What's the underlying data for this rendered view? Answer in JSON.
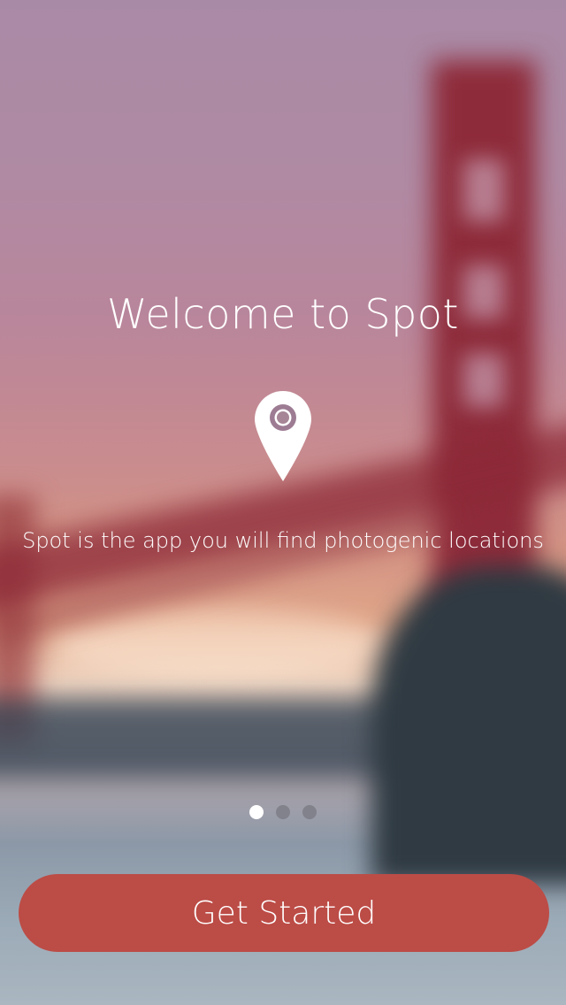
{
  "onboarding": {
    "title": "Welcome to Spot",
    "subtitle": "Spot is the app you will find photogenic locations",
    "pin_icon": "map-pin-icon",
    "pages": {
      "count": 3,
      "active_index": 0
    },
    "cta_label": "Get Started"
  },
  "colors": {
    "accent": "#bc4c46",
    "text": "#ffffff",
    "dot_inactive": "#787882"
  }
}
